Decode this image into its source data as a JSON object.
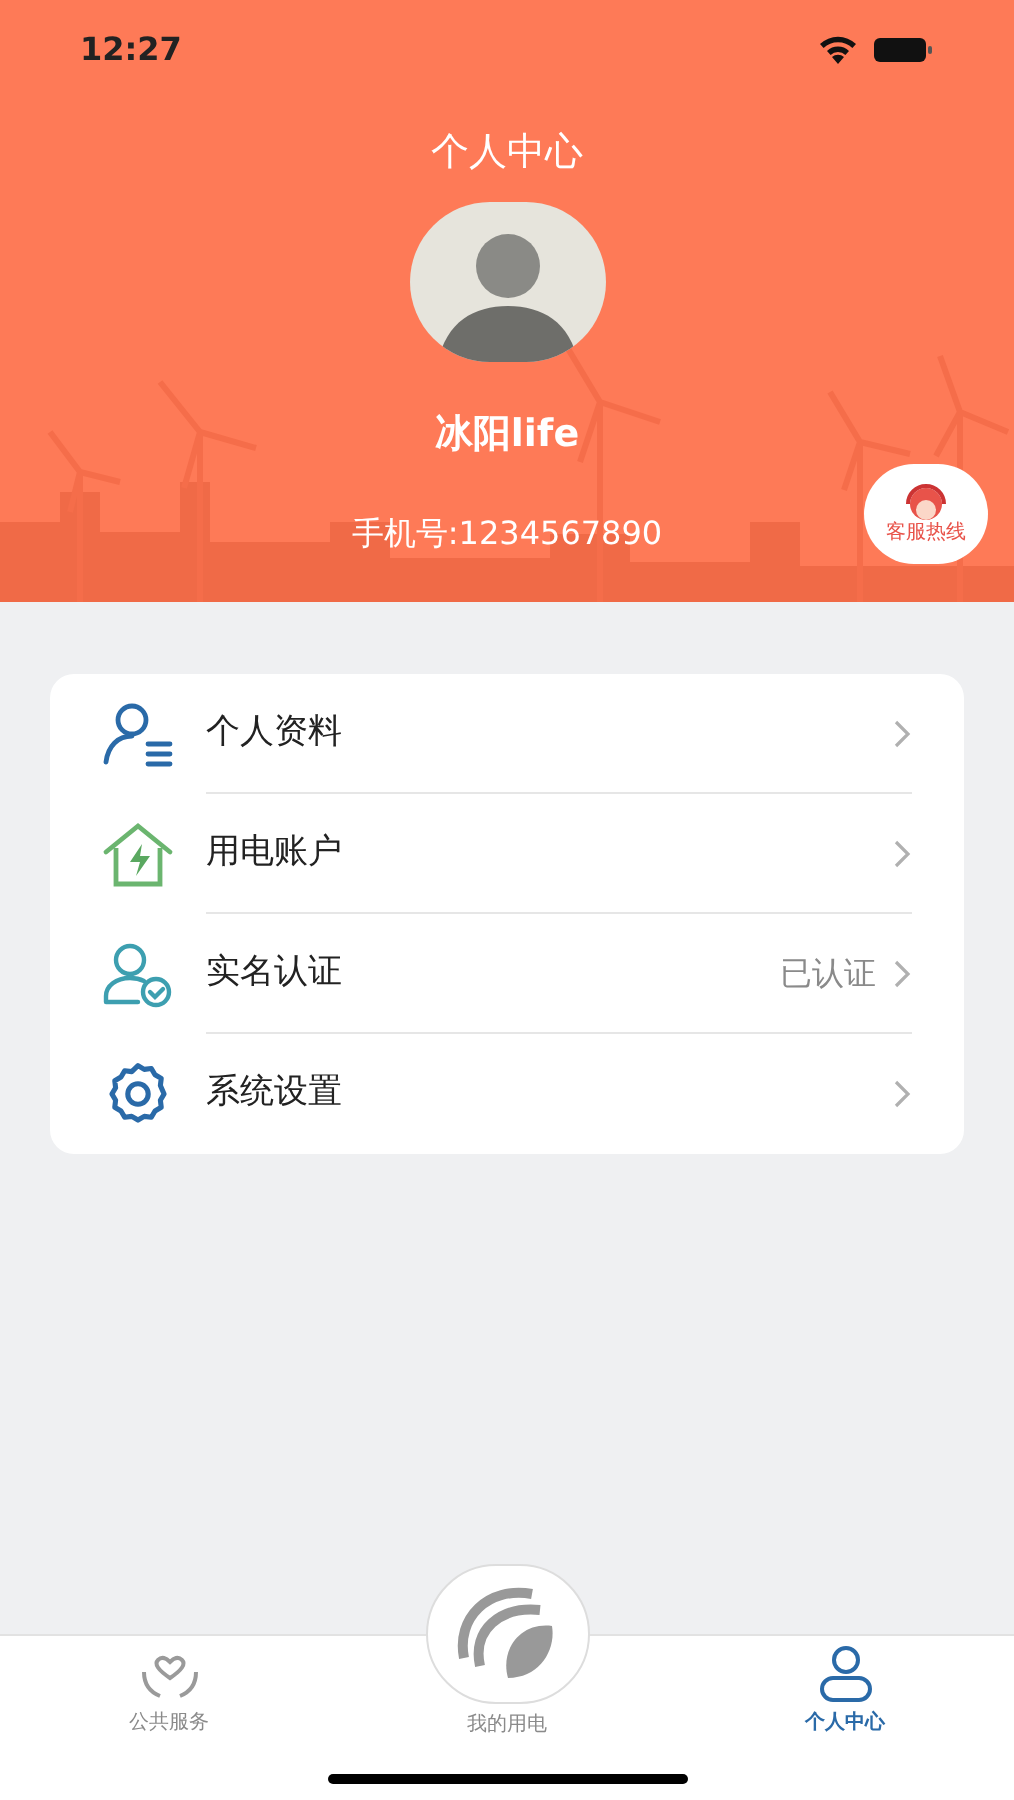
{
  "status_bar": {
    "time": "12:27"
  },
  "header": {
    "title": "个人中心",
    "name": "冰阳life",
    "phone": "手机号:1234567890",
    "hotline": "客服热线"
  },
  "menu": [
    {
      "label": "个人资料"
    },
    {
      "label": "用电账户"
    },
    {
      "label": "实名认证",
      "value": "已认证"
    },
    {
      "label": "系统设置"
    }
  ],
  "tabs": [
    {
      "label": "公共服务",
      "selected": false
    },
    {
      "label": "我的用电",
      "selected": false
    },
    {
      "label": "个人中心",
      "selected": true
    }
  ]
}
